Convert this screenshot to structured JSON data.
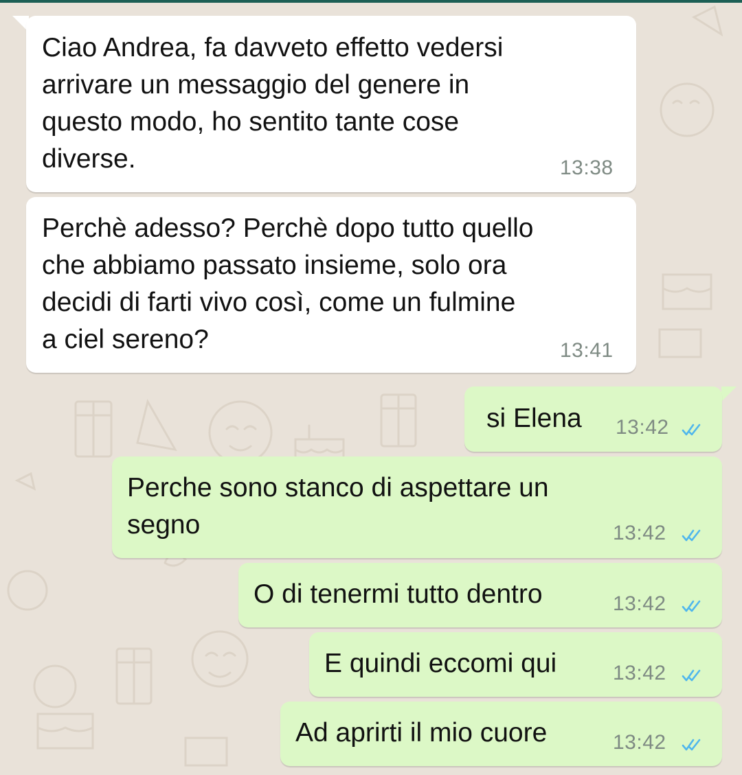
{
  "colors": {
    "wallpaper": "#e9e2d9",
    "incoming_bubble": "#ffffff",
    "outgoing_bubble": "#dcf8c6",
    "read_ticks": "#4fb6ec",
    "timestamp": "#7e8a83"
  },
  "messages": [
    {
      "direction": "incoming",
      "text": "Ciao Andrea, fa davveto effetto vedersi\narrivare un messaggio del genere in\nquesto modo, ho sentito tante cose\ndiverse.",
      "time": "13:38"
    },
    {
      "direction": "incoming",
      "text": "Perchè adesso? Perchè dopo tutto quello\nche abbiamo passato insieme, solo ora\ndecidi di farti vivo così, come un fulmine\na ciel sereno?",
      "time": "13:41"
    },
    {
      "direction": "outgoing",
      "text": "si Elena",
      "time": "13:42",
      "status_icon": "double-check-read-icon"
    },
    {
      "direction": "outgoing",
      "text": "Perche sono stanco di aspettare un\nsegno",
      "time": "13:42",
      "status_icon": "double-check-read-icon"
    },
    {
      "direction": "outgoing",
      "text": "O di tenermi tutto dentro",
      "time": "13:42",
      "status_icon": "double-check-read-icon"
    },
    {
      "direction": "outgoing",
      "text": "E quindi eccomi qui",
      "time": "13:42",
      "status_icon": "double-check-read-icon"
    },
    {
      "direction": "outgoing",
      "text": "Ad aprirti il mio cuore",
      "time": "13:42",
      "status_icon": "double-check-read-icon"
    }
  ]
}
